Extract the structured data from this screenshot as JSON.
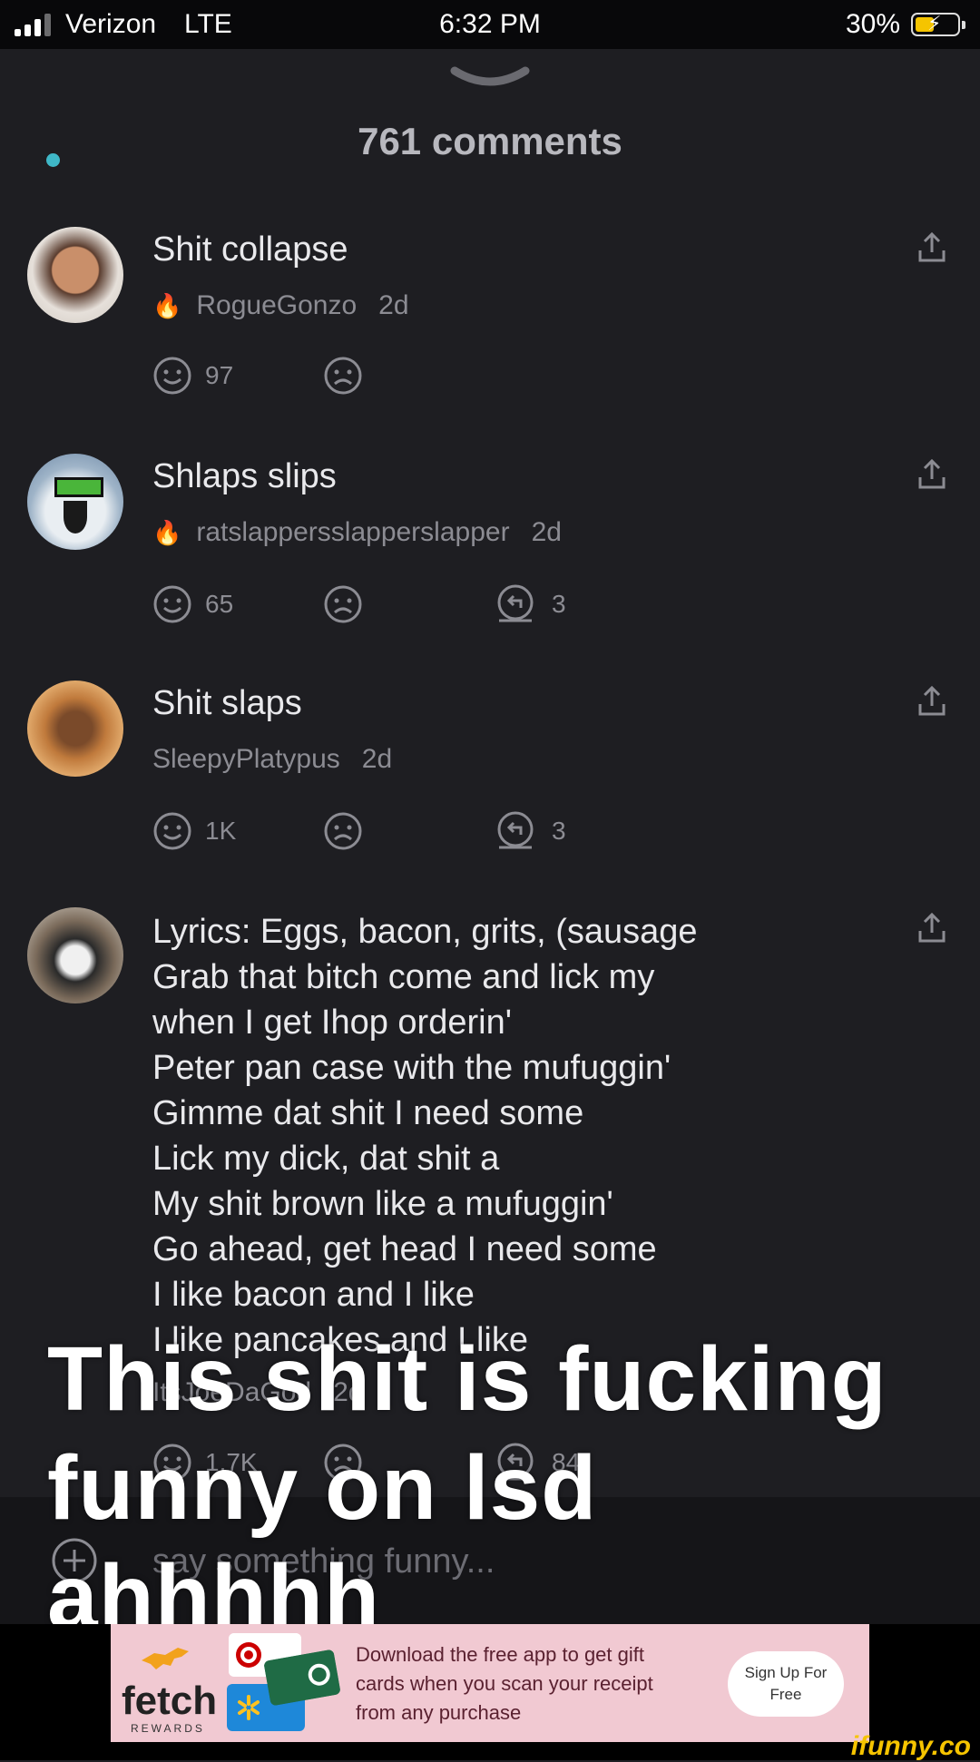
{
  "status_bar": {
    "carrier": "Verizon",
    "network": "LTE",
    "time": "6:32 PM",
    "battery": "30%",
    "battery_level": 0.3
  },
  "header": {
    "title": "761 comments"
  },
  "comments": [
    {
      "text": "Shit collapse",
      "author": "RogueGonzo",
      "age": "2d",
      "likes": "97",
      "replies": "",
      "flame": true
    },
    {
      "text": "Shlaps slips",
      "author": "ratslappersslapperslapper",
      "age": "2d",
      "likes": "65",
      "replies": "3",
      "flame": true
    },
    {
      "text": "Shit slaps",
      "author": "SleepyPlatypus",
      "age": "2d",
      "likes": "1K",
      "replies": "3",
      "flame": false
    },
    {
      "lines": [
        "Lyrics: Eggs, bacon, grits, (sausage",
        "Grab that bitch come and lick my",
        "when I get Ihop orderin'",
        "Peter pan case with the mufuggin'",
        "Gimme dat shit I need some",
        "Lick my dick, dat shit a",
        "My shit brown like a mufuggin'",
        "Go ahead, get head I need some",
        "I like bacon and I like",
        "I like pancakes and I like"
      ],
      "author": "ItsJoeDaGod",
      "age": "2d",
      "likes": "1.7K",
      "replies": "84",
      "flame": false
    }
  ],
  "input": {
    "placeholder": "say something funny..."
  },
  "caption": [
    "This shit is fucking",
    "funny on lsd",
    "ahhhhh"
  ],
  "ad": {
    "brand": "fetch",
    "brand_sub": "REWARDS",
    "text": "Download the free app to get gift cards when you scan your receipt from any purchase",
    "button": "Sign Up For\nFree"
  },
  "watermark": "ifunny.co",
  "colors": {
    "background": "#1e1e22",
    "accent_dot": "#3fb8c8",
    "flame": "#f28b1b",
    "ad_bg": "#f1c9d2"
  }
}
